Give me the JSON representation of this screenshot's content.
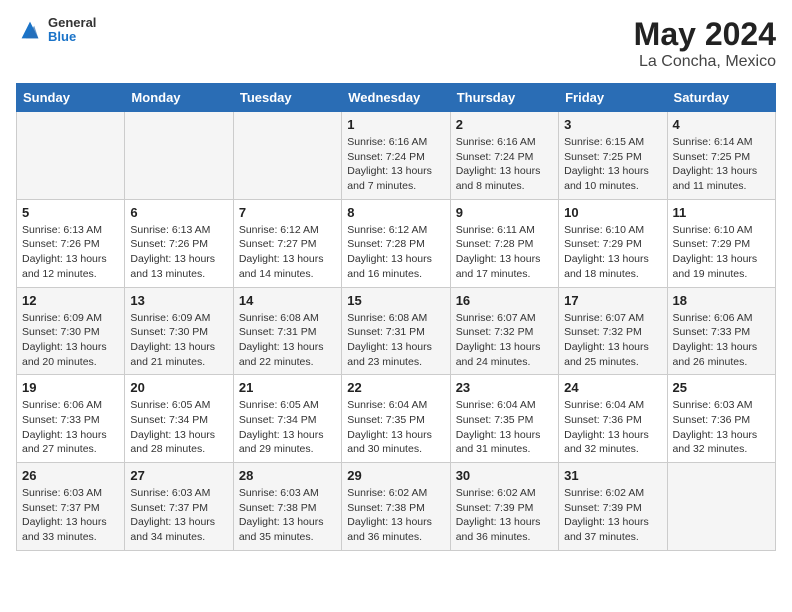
{
  "header": {
    "logo": {
      "general": "General",
      "blue": "Blue"
    },
    "title": "May 2024",
    "subtitle": "La Concha, Mexico"
  },
  "weekdays": [
    "Sunday",
    "Monday",
    "Tuesday",
    "Wednesday",
    "Thursday",
    "Friday",
    "Saturday"
  ],
  "weeks": [
    [
      null,
      null,
      null,
      {
        "day": 1,
        "sunrise": "6:16 AM",
        "sunset": "7:24 PM",
        "daylight": "13 hours and 7 minutes."
      },
      {
        "day": 2,
        "sunrise": "6:16 AM",
        "sunset": "7:24 PM",
        "daylight": "13 hours and 8 minutes."
      },
      {
        "day": 3,
        "sunrise": "6:15 AM",
        "sunset": "7:25 PM",
        "daylight": "13 hours and 10 minutes."
      },
      {
        "day": 4,
        "sunrise": "6:14 AM",
        "sunset": "7:25 PM",
        "daylight": "13 hours and 11 minutes."
      }
    ],
    [
      {
        "day": 5,
        "sunrise": "6:13 AM",
        "sunset": "7:26 PM",
        "daylight": "13 hours and 12 minutes."
      },
      {
        "day": 6,
        "sunrise": "6:13 AM",
        "sunset": "7:26 PM",
        "daylight": "13 hours and 13 minutes."
      },
      {
        "day": 7,
        "sunrise": "6:12 AM",
        "sunset": "7:27 PM",
        "daylight": "13 hours and 14 minutes."
      },
      {
        "day": 8,
        "sunrise": "6:12 AM",
        "sunset": "7:28 PM",
        "daylight": "13 hours and 16 minutes."
      },
      {
        "day": 9,
        "sunrise": "6:11 AM",
        "sunset": "7:28 PM",
        "daylight": "13 hours and 17 minutes."
      },
      {
        "day": 10,
        "sunrise": "6:10 AM",
        "sunset": "7:29 PM",
        "daylight": "13 hours and 18 minutes."
      },
      {
        "day": 11,
        "sunrise": "6:10 AM",
        "sunset": "7:29 PM",
        "daylight": "13 hours and 19 minutes."
      }
    ],
    [
      {
        "day": 12,
        "sunrise": "6:09 AM",
        "sunset": "7:30 PM",
        "daylight": "13 hours and 20 minutes."
      },
      {
        "day": 13,
        "sunrise": "6:09 AM",
        "sunset": "7:30 PM",
        "daylight": "13 hours and 21 minutes."
      },
      {
        "day": 14,
        "sunrise": "6:08 AM",
        "sunset": "7:31 PM",
        "daylight": "13 hours and 22 minutes."
      },
      {
        "day": 15,
        "sunrise": "6:08 AM",
        "sunset": "7:31 PM",
        "daylight": "13 hours and 23 minutes."
      },
      {
        "day": 16,
        "sunrise": "6:07 AM",
        "sunset": "7:32 PM",
        "daylight": "13 hours and 24 minutes."
      },
      {
        "day": 17,
        "sunrise": "6:07 AM",
        "sunset": "7:32 PM",
        "daylight": "13 hours and 25 minutes."
      },
      {
        "day": 18,
        "sunrise": "6:06 AM",
        "sunset": "7:33 PM",
        "daylight": "13 hours and 26 minutes."
      }
    ],
    [
      {
        "day": 19,
        "sunrise": "6:06 AM",
        "sunset": "7:33 PM",
        "daylight": "13 hours and 27 minutes."
      },
      {
        "day": 20,
        "sunrise": "6:05 AM",
        "sunset": "7:34 PM",
        "daylight": "13 hours and 28 minutes."
      },
      {
        "day": 21,
        "sunrise": "6:05 AM",
        "sunset": "7:34 PM",
        "daylight": "13 hours and 29 minutes."
      },
      {
        "day": 22,
        "sunrise": "6:04 AM",
        "sunset": "7:35 PM",
        "daylight": "13 hours and 30 minutes."
      },
      {
        "day": 23,
        "sunrise": "6:04 AM",
        "sunset": "7:35 PM",
        "daylight": "13 hours and 31 minutes."
      },
      {
        "day": 24,
        "sunrise": "6:04 AM",
        "sunset": "7:36 PM",
        "daylight": "13 hours and 32 minutes."
      },
      {
        "day": 25,
        "sunrise": "6:03 AM",
        "sunset": "7:36 PM",
        "daylight": "13 hours and 32 minutes."
      }
    ],
    [
      {
        "day": 26,
        "sunrise": "6:03 AM",
        "sunset": "7:37 PM",
        "daylight": "13 hours and 33 minutes."
      },
      {
        "day": 27,
        "sunrise": "6:03 AM",
        "sunset": "7:37 PM",
        "daylight": "13 hours and 34 minutes."
      },
      {
        "day": 28,
        "sunrise": "6:03 AM",
        "sunset": "7:38 PM",
        "daylight": "13 hours and 35 minutes."
      },
      {
        "day": 29,
        "sunrise": "6:02 AM",
        "sunset": "7:38 PM",
        "daylight": "13 hours and 36 minutes."
      },
      {
        "day": 30,
        "sunrise": "6:02 AM",
        "sunset": "7:39 PM",
        "daylight": "13 hours and 36 minutes."
      },
      {
        "day": 31,
        "sunrise": "6:02 AM",
        "sunset": "7:39 PM",
        "daylight": "13 hours and 37 minutes."
      },
      null
    ]
  ]
}
